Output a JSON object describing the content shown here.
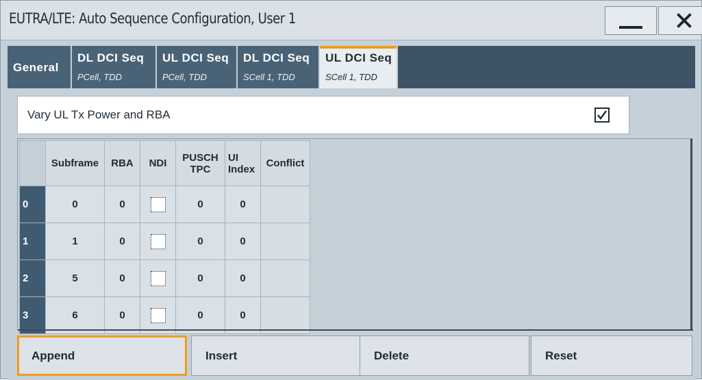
{
  "window": {
    "title": "EUTRA/LTE: Auto Sequence Configuration, User 1",
    "minimize_icon": "minimize-icon",
    "close_icon": "close-icon"
  },
  "tabs": [
    {
      "label": "General",
      "sub": "",
      "active": false
    },
    {
      "label": "DL DCI Seq",
      "sub": "PCell, TDD",
      "active": false
    },
    {
      "label": "UL DCI Seq",
      "sub": "PCell, TDD",
      "active": false
    },
    {
      "label": "DL DCI Seq",
      "sub": "SCell 1, TDD",
      "active": false
    },
    {
      "label": "UL DCI Seq",
      "sub": "SCell 1, TDD",
      "active": true
    }
  ],
  "vary": {
    "label": "Vary UL Tx Power and RBA",
    "checked": true,
    "checkmark": "✓"
  },
  "table": {
    "headers": {
      "subframe": "Subframe",
      "rba": "RBA",
      "ndi": "NDI",
      "pusch_tpc_line1": "PUSCH",
      "pusch_tpc_line2": "TPC",
      "ui_index_line1": "UI",
      "ui_index_line2": "Index",
      "conflict": "Conflict"
    },
    "rows": [
      {
        "index": "0",
        "subframe": "0",
        "rba": "0",
        "ndi": false,
        "pusch_tpc": "0",
        "ui_index": "0",
        "conflict": ""
      },
      {
        "index": "1",
        "subframe": "1",
        "rba": "0",
        "ndi": false,
        "pusch_tpc": "0",
        "ui_index": "0",
        "conflict": ""
      },
      {
        "index": "2",
        "subframe": "5",
        "rba": "0",
        "ndi": false,
        "pusch_tpc": "0",
        "ui_index": "0",
        "conflict": ""
      },
      {
        "index": "3",
        "subframe": "6",
        "rba": "0",
        "ndi": false,
        "pusch_tpc": "0",
        "ui_index": "0",
        "conflict": ""
      }
    ]
  },
  "actions": {
    "append": "Append",
    "insert": "Insert",
    "delete": "Delete",
    "reset": "Reset"
  },
  "colors": {
    "accent": "#f29b1d",
    "tab_bg": "#4a6276",
    "row_header_bg": "#3f5b72",
    "panel_bg": "#c5d0d8"
  }
}
